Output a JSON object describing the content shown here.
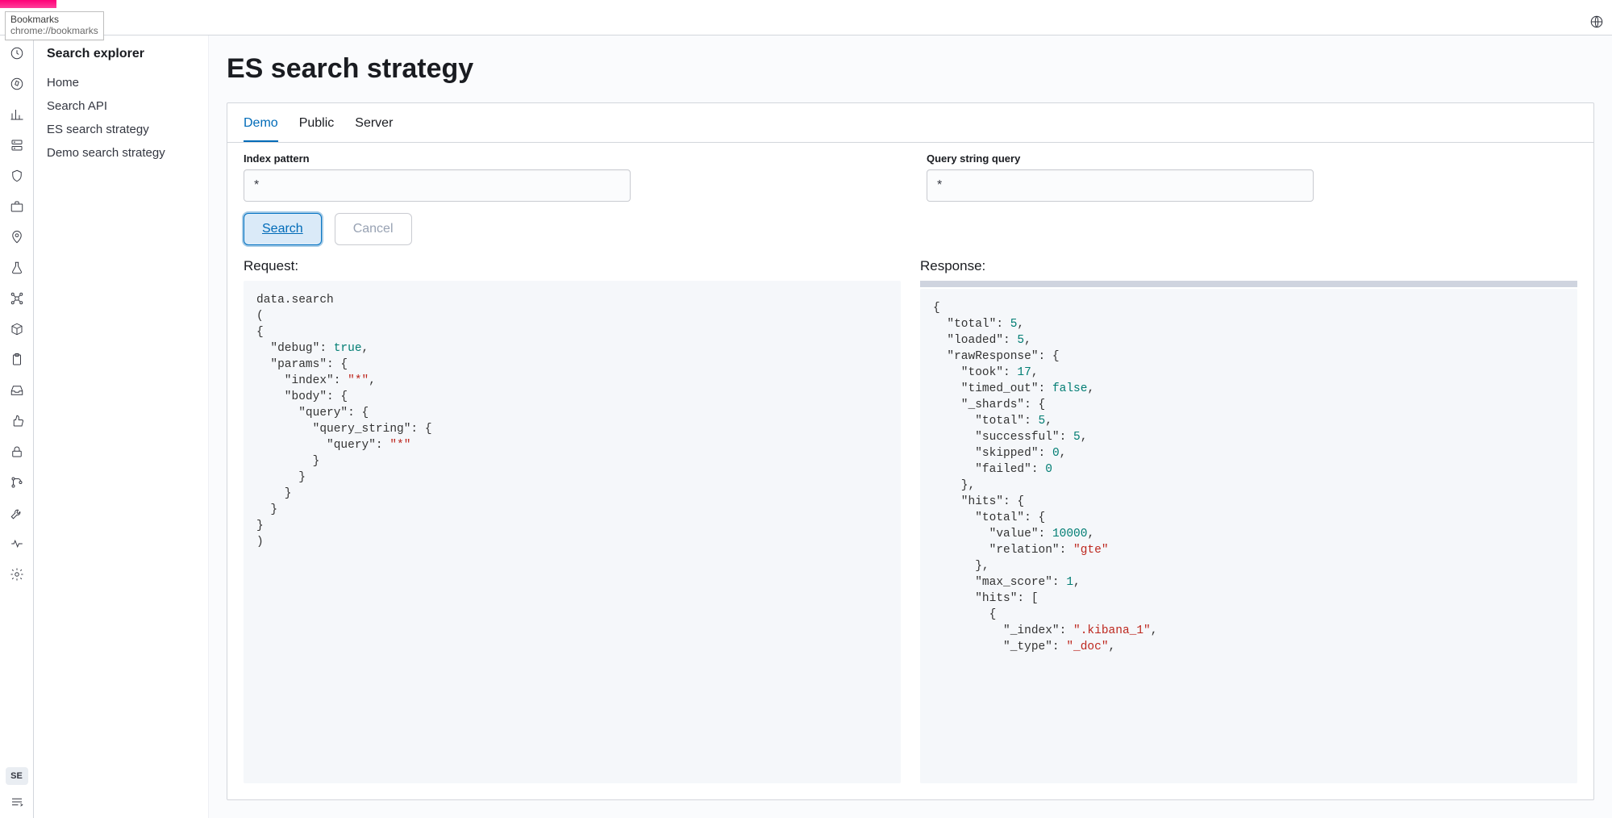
{
  "chrome": {
    "tooltip_title": "Bookmarks",
    "tooltip_url": "chrome://bookmarks"
  },
  "header": {
    "right_icon": "globe-icon"
  },
  "rail": {
    "items": [
      "clock-icon",
      "compass-icon",
      "chart-icon",
      "server-icon",
      "shield-icon",
      "briefcase-icon",
      "pin-icon",
      "flask-icon",
      "network-icon",
      "package-icon",
      "clipboard-icon",
      "inbox-icon",
      "thumbs-up-icon",
      "lock-icon",
      "git-icon",
      "wrench-icon",
      "heart-rate-icon",
      "gear-icon"
    ],
    "badge_text": "SE"
  },
  "sidebar": {
    "title": "Search explorer",
    "items": [
      {
        "label": "Home"
      },
      {
        "label": "Search API"
      },
      {
        "label": "ES search strategy"
      },
      {
        "label": "Demo search strategy"
      }
    ]
  },
  "page": {
    "title": "ES search strategy"
  },
  "tabs": [
    {
      "label": "Demo",
      "active": true
    },
    {
      "label": "Public",
      "active": false
    },
    {
      "label": "Server",
      "active": false
    }
  ],
  "form": {
    "index_label": "Index pattern",
    "index_value": "*",
    "query_label": "Query string query",
    "query_value": "*",
    "search_btn": "Search",
    "cancel_btn": "Cancel"
  },
  "request": {
    "title": "Request:",
    "lines": [
      {
        "t": "data.search"
      },
      {
        "t": "("
      },
      {
        "t": "{"
      },
      {
        "t": "  \"debug\": ",
        "post": ",",
        "val": "true",
        "kind": "n"
      },
      {
        "t": "  \"params\": {"
      },
      {
        "t": "    \"index\": ",
        "post": ",",
        "val": "\"*\"",
        "kind": "s"
      },
      {
        "t": "    \"body\": {"
      },
      {
        "t": "      \"query\": {"
      },
      {
        "t": "        \"query_string\": {"
      },
      {
        "t": "          \"query\": ",
        "val": "\"*\"",
        "kind": "s"
      },
      {
        "t": "        }"
      },
      {
        "t": "      }"
      },
      {
        "t": "    }"
      },
      {
        "t": "  }"
      },
      {
        "t": "}"
      },
      {
        "t": ")"
      }
    ]
  },
  "response": {
    "title": "Response:",
    "lines": [
      {
        "t": "{"
      },
      {
        "t": "  \"total\": ",
        "post": ",",
        "val": "5",
        "kind": "n"
      },
      {
        "t": "  \"loaded\": ",
        "post": ",",
        "val": "5",
        "kind": "n"
      },
      {
        "t": "  \"rawResponse\": {"
      },
      {
        "t": "    \"took\": ",
        "post": ",",
        "val": "17",
        "kind": "n"
      },
      {
        "t": "    \"timed_out\": ",
        "post": ",",
        "val": "false",
        "kind": "n"
      },
      {
        "t": "    \"_shards\": {"
      },
      {
        "t": "      \"total\": ",
        "post": ",",
        "val": "5",
        "kind": "n"
      },
      {
        "t": "      \"successful\": ",
        "post": ",",
        "val": "5",
        "kind": "n"
      },
      {
        "t": "      \"skipped\": ",
        "post": ",",
        "val": "0",
        "kind": "n"
      },
      {
        "t": "      \"failed\": ",
        "val": "0",
        "kind": "n"
      },
      {
        "t": "    },"
      },
      {
        "t": "    \"hits\": {"
      },
      {
        "t": "      \"total\": {"
      },
      {
        "t": "        \"value\": ",
        "post": ",",
        "val": "10000",
        "kind": "n"
      },
      {
        "t": "        \"relation\": ",
        "val": "\"gte\"",
        "kind": "s"
      },
      {
        "t": "      },"
      },
      {
        "t": "      \"max_score\": ",
        "post": ",",
        "val": "1",
        "kind": "n"
      },
      {
        "t": "      \"hits\": ["
      },
      {
        "t": "        {"
      },
      {
        "t": "          \"_index\": ",
        "post": ",",
        "val": "\".kibana_1\"",
        "kind": "s"
      },
      {
        "t": "          \"_type\": ",
        "post": ",",
        "val": "\"_doc\"",
        "kind": "s"
      }
    ]
  }
}
